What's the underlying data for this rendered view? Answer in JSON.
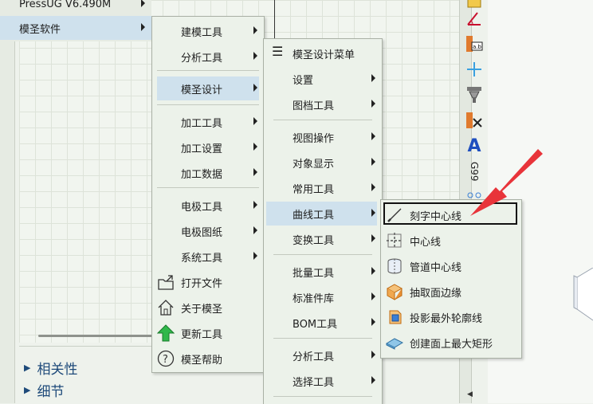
{
  "left_panel": {
    "rows": [
      {
        "label": "相关性"
      },
      {
        "label": "细节"
      }
    ]
  },
  "toolbar": {
    "text_tool": "A",
    "g99": "G99"
  },
  "menu1": {
    "items": [
      {
        "label": "PressUG  V6.490M"
      },
      {
        "label": "模圣软件"
      }
    ]
  },
  "menu2": {
    "items": [
      {
        "label": "建模工具"
      },
      {
        "label": "分析工具"
      },
      {
        "label": "模圣设计"
      },
      {
        "label": "加工工具"
      },
      {
        "label": "加工设置"
      },
      {
        "label": "加工数据"
      },
      {
        "label": "电极工具"
      },
      {
        "label": "电极图纸"
      },
      {
        "label": "系统工具"
      },
      {
        "label": "打开文件"
      },
      {
        "label": "关于模圣"
      },
      {
        "label": "更新工具"
      },
      {
        "label": "模圣帮助"
      }
    ]
  },
  "menu3": {
    "items": [
      {
        "label": "模圣设计菜单"
      },
      {
        "label": "设置"
      },
      {
        "label": "图档工具"
      },
      {
        "label": "视图操作"
      },
      {
        "label": "对象显示"
      },
      {
        "label": "常用工具"
      },
      {
        "label": "曲线工具"
      },
      {
        "label": "变换工具"
      },
      {
        "label": "批量工具"
      },
      {
        "label": "标准件库"
      },
      {
        "label": "BOM工具"
      },
      {
        "label": "分析工具"
      },
      {
        "label": "选择工具"
      }
    ]
  },
  "menu4": {
    "items": [
      {
        "label": "刻字中心线"
      },
      {
        "label": "中心线"
      },
      {
        "label": "管道中心线"
      },
      {
        "label": "抽取面边缘"
      },
      {
        "label": "投影最外轮廓线"
      },
      {
        "label": "创建面上最大矩形"
      }
    ]
  },
  "colors": {
    "highlight": "#cfe1ed",
    "menu_bg": "#ecf2ea",
    "annotation_arrow": "#e8343a",
    "panel_text": "#1e4a7a"
  }
}
